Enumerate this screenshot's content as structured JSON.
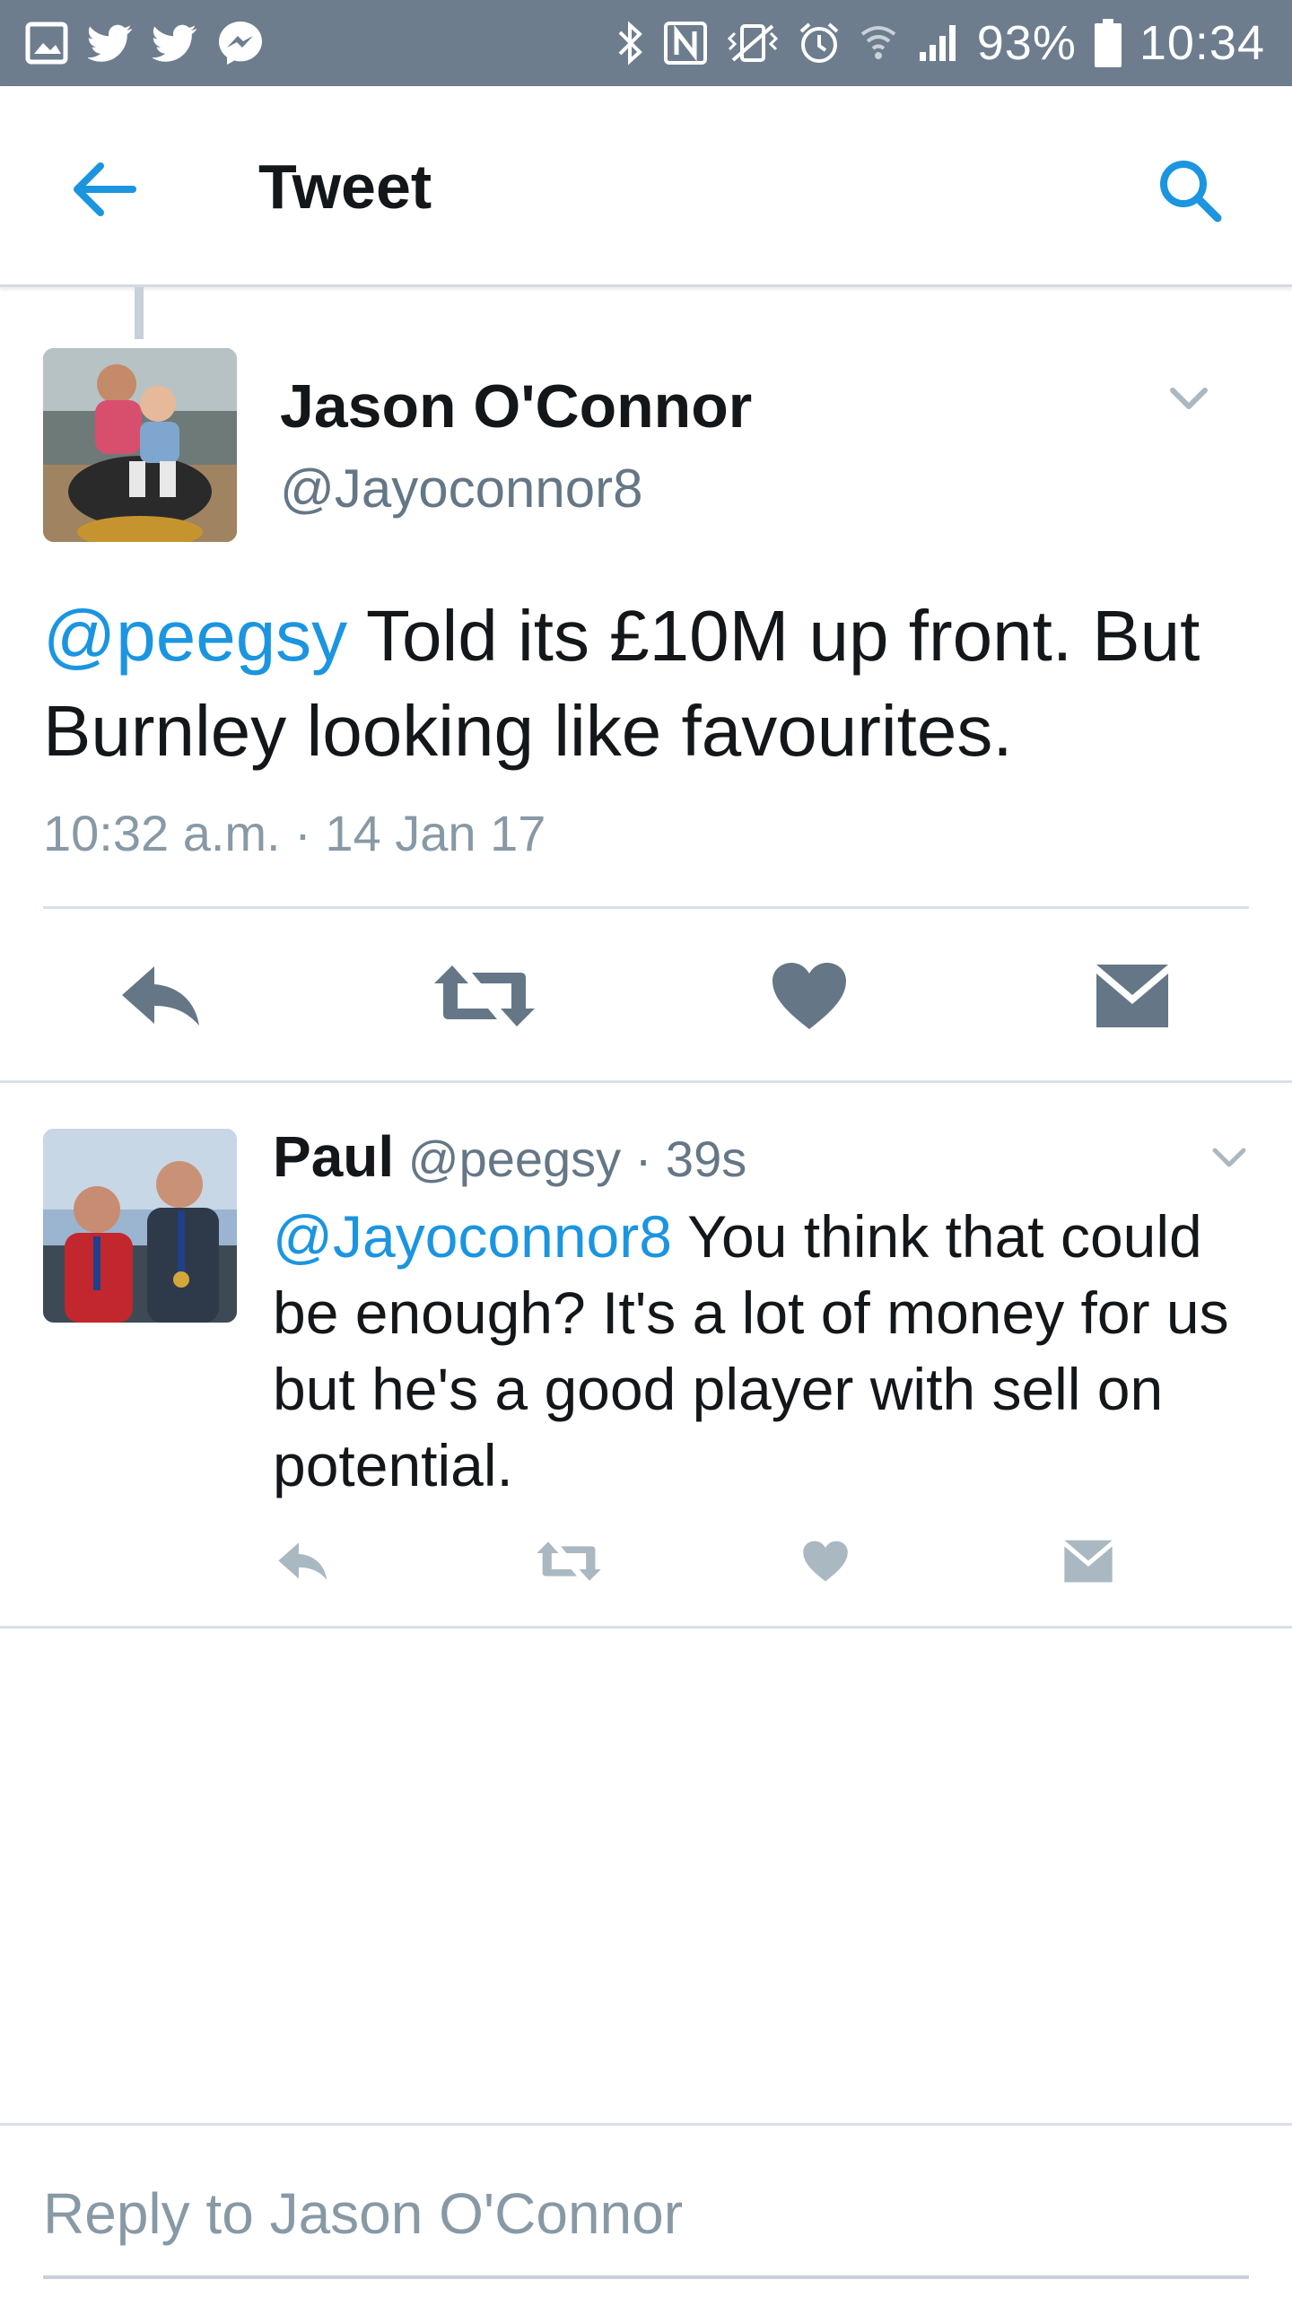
{
  "status_bar": {
    "battery": "93%",
    "time": "10:34"
  },
  "header": {
    "title": "Tweet"
  },
  "tweet": {
    "name": "Jason O'Connor",
    "handle": "@Jayoconnor8",
    "mention": "@peegsy",
    "body": " Told its £10M up front. But Burnley looking like favourites.",
    "timestamp": "10:32 a.m. · 14 Jan 17"
  },
  "reply": {
    "name": "Paul",
    "handle": "@peegsy",
    "age": "· 39s",
    "mention": "@Jayoconnor8",
    "body": " You think that could be enough? It's a lot of money for us but he's a good player with sell on potential."
  },
  "composer": {
    "placeholder": "Reply to Jason O'Connor"
  },
  "colors": {
    "status_bar": "#6d7d8e",
    "accent": "#1b95e0",
    "action_icons_main": "#657786",
    "action_icons_reply": "#aab8c2"
  }
}
